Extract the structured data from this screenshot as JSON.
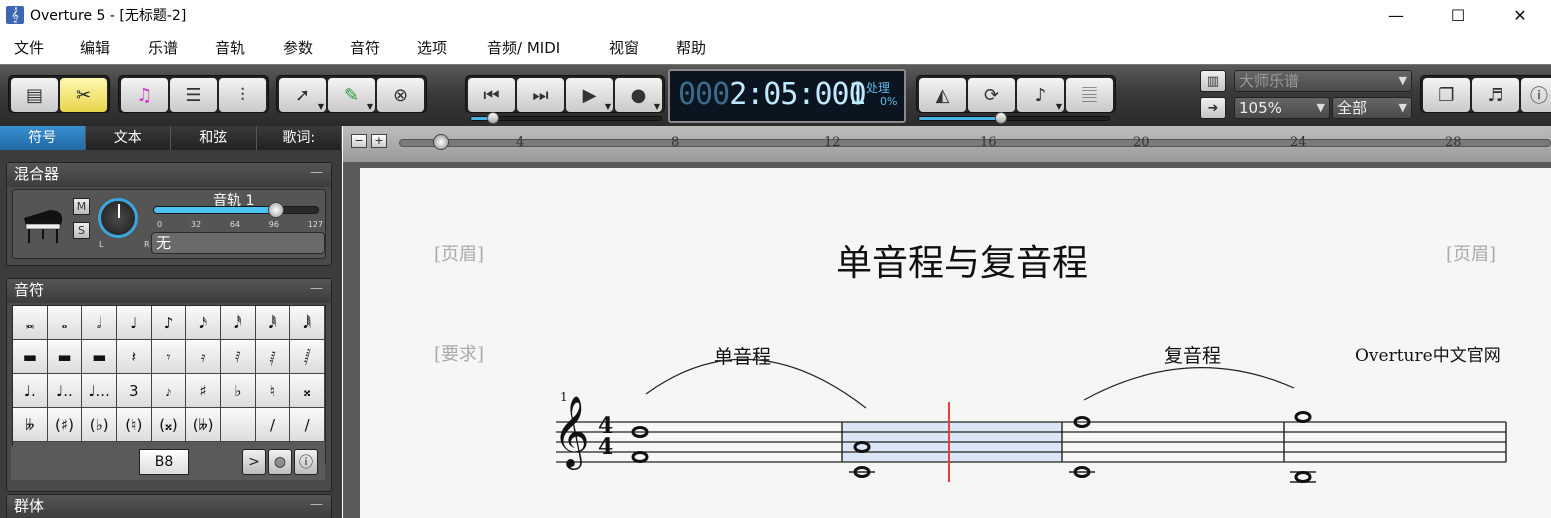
{
  "window": {
    "title": "Overture 5 - [无标题-2]",
    "minimize": "—",
    "maximize": "☐",
    "close": "✕"
  },
  "menu": [
    "文件",
    "编辑",
    "乐谱",
    "音轨",
    "参数",
    "音符",
    "选项",
    "音频/ MIDI",
    "视窗",
    "帮助"
  ],
  "transport": {
    "time_dim": "000",
    "time_main": "2:05:000",
    "beat": "1",
    "processing": "处理",
    "percent": "0%"
  },
  "score_selector": {
    "value": "大师乐谱"
  },
  "zoom": {
    "value": "105%"
  },
  "view_range": {
    "value": "全部"
  },
  "panel_tabs": [
    "符号",
    "文本",
    "和弦",
    "歌词:"
  ],
  "mixer": {
    "title": "混合器",
    "mute": "M",
    "solo": "S",
    "pan_left": "L",
    "pan_right": "R",
    "track_label": "音轨 1",
    "volume_scale": [
      "0",
      "32",
      "64",
      "96",
      "127"
    ],
    "volume_value": 96,
    "instrument": "无"
  },
  "notes_palette": {
    "title": "音符",
    "rows": [
      [
        "𝅜",
        "𝅝",
        "𝅗𝅥",
        "♩",
        "♪",
        "𝅘𝅥𝅯",
        "𝅘𝅥𝅰",
        "𝅘𝅥𝅱",
        "𝅘𝅥𝅲"
      ],
      [
        "▬",
        "▬",
        "▬",
        "𝄽",
        "𝄾",
        "𝄿",
        "𝅀",
        "𝅁",
        "𝅂"
      ],
      [
        "♩.",
        "♩..",
        "♩...",
        "3",
        "𝆔",
        "♯",
        "♭",
        "♮",
        "𝄪"
      ],
      [
        "𝄫",
        "(♯)",
        "(♭)",
        "(♮)",
        "(𝄪)",
        "(𝄫)",
        "",
        "/",
        "/"
      ]
    ],
    "selected_pitch": "B8",
    "accent": ">"
  },
  "groups_panel": {
    "title": "群体"
  },
  "ruler": {
    "marks": [
      "4",
      "8",
      "12",
      "16",
      "20",
      "24",
      "28"
    ]
  },
  "score": {
    "title": "单音程与复音程",
    "header_left": "[页眉]",
    "header_right": "[页眉]",
    "requirement": "[要求]",
    "composer": "Overture中文官网",
    "label_simple": "单音程",
    "label_compound": "复音程",
    "measure_number": "1",
    "time_sig_top": "4",
    "time_sig_bottom": "4"
  },
  "colors": {
    "accent_blue": "#3aa6dd",
    "lcd_text": "#bfe9ff",
    "playhead": "#e04040",
    "selection": "#cfe0f5"
  }
}
